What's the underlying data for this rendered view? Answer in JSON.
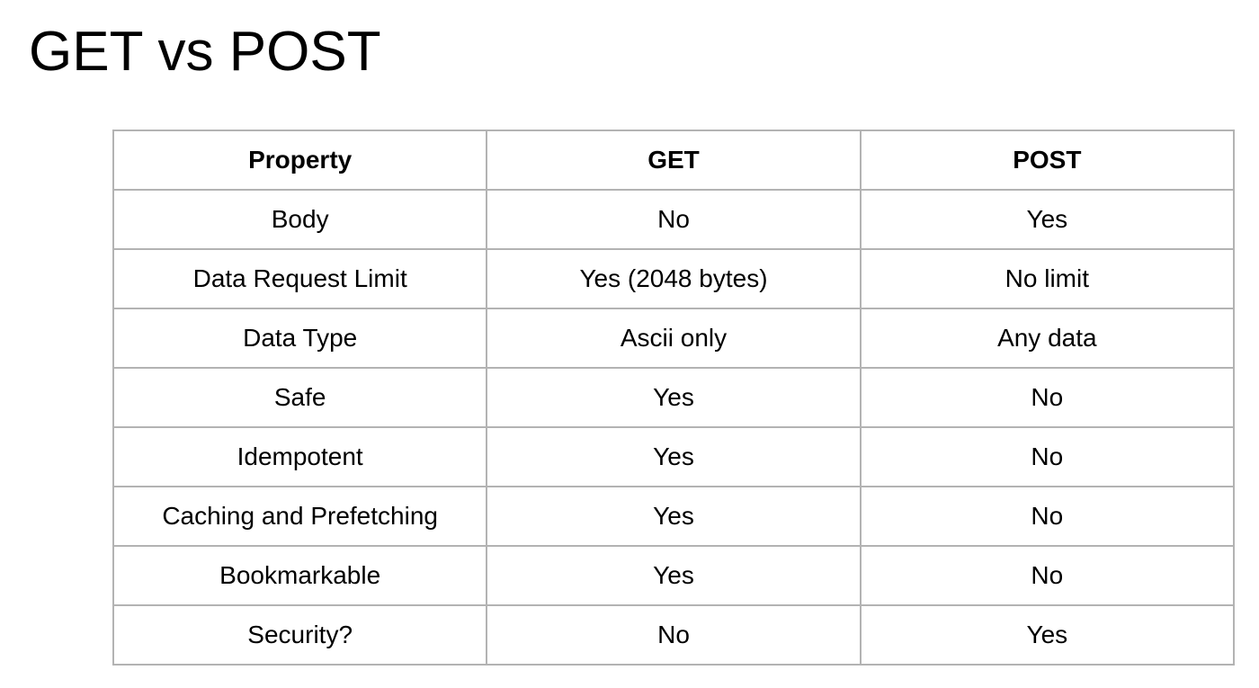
{
  "slide": {
    "title": "GET vs POST"
  },
  "table": {
    "headers": [
      "Property",
      "GET",
      "POST"
    ],
    "rows": [
      [
        "Body",
        "No",
        "Yes"
      ],
      [
        "Data Request Limit",
        "Yes (2048 bytes)",
        "No limit"
      ],
      [
        "Data Type",
        "Ascii only",
        "Any data"
      ],
      [
        "Safe",
        "Yes",
        "No"
      ],
      [
        "Idempotent",
        "Yes",
        "No"
      ],
      [
        "Caching and Prefetching",
        "Yes",
        "No"
      ],
      [
        "Bookmarkable",
        "Yes",
        "No"
      ],
      [
        "Security?",
        "No",
        "Yes"
      ]
    ]
  }
}
